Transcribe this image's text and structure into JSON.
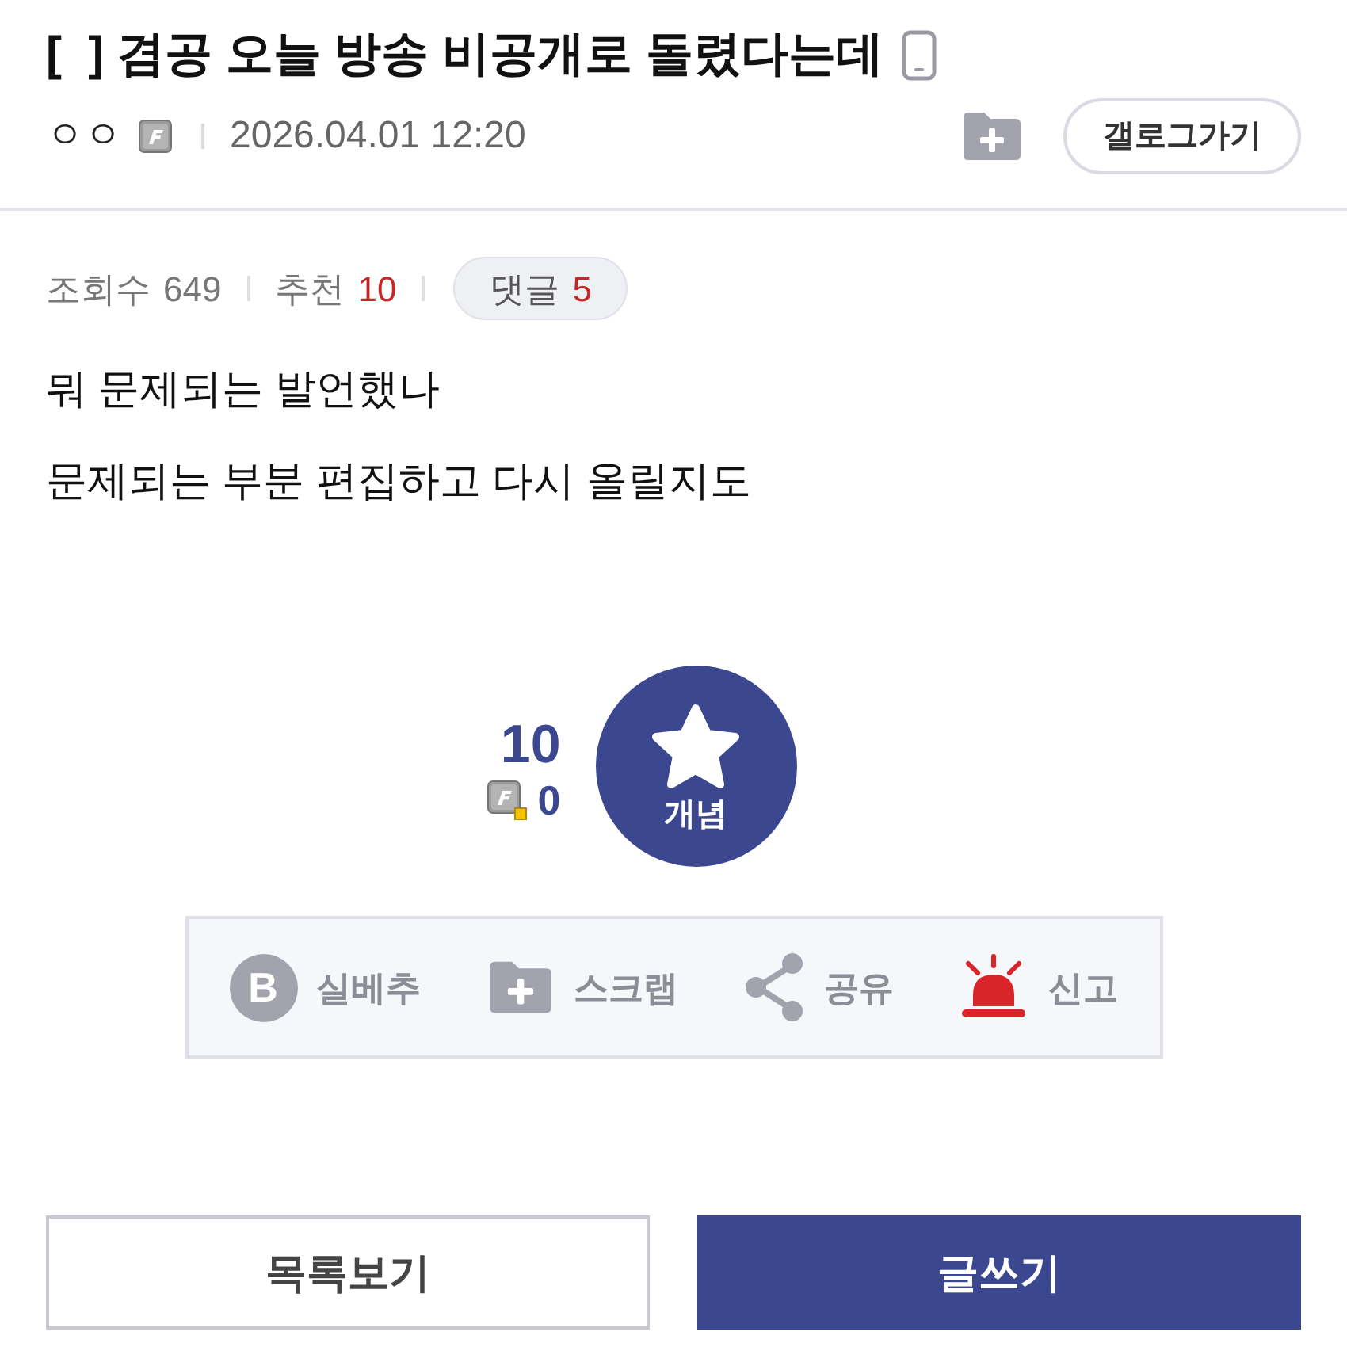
{
  "post": {
    "title": "[  ] 겸공 오늘 방송 비공개로 돌렸다는데",
    "author": "ㅇㅇ",
    "date": "2026.04.01 12:20",
    "gallog_button": "갤로그가기"
  },
  "stats": {
    "views_label": "조회수",
    "views": "649",
    "recommend_label": "추천",
    "recommend": "10",
    "comments_label": "댓글",
    "comments": "5"
  },
  "body": [
    "뭐 문제되는 발언했나",
    "문제되는 부분 편집하고 다시 올릴지도"
  ],
  "vote": {
    "count": "10",
    "fixed_count": "0",
    "button": "개념"
  },
  "actions": [
    {
      "kind": "best",
      "glyph": "B",
      "label": "실베추"
    },
    {
      "kind": "scrap",
      "label": "스크랩"
    },
    {
      "kind": "share",
      "label": "공유"
    },
    {
      "kind": "report",
      "label": "신고"
    }
  ],
  "buttons": [
    {
      "kind": "outline",
      "label": "목록보기"
    },
    {
      "kind": "filled",
      "label": "글쓰기"
    }
  ]
}
